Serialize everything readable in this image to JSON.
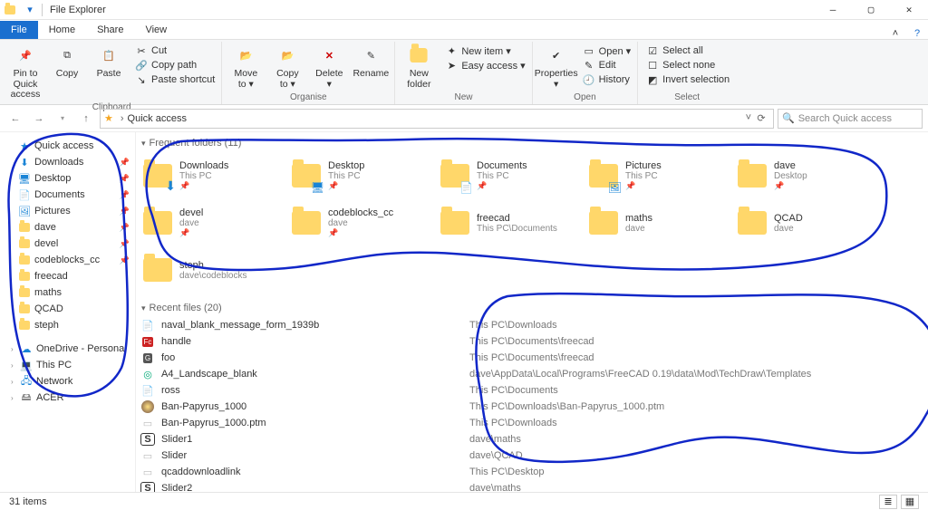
{
  "titlebar": {
    "title": "File Explorer"
  },
  "winbtns": {
    "min": "—",
    "max": "▢",
    "close": "✕"
  },
  "tabs": {
    "file": "File",
    "home": "Home",
    "share": "Share",
    "view": "View",
    "collapse": "˄",
    "help": "?"
  },
  "ribbon": {
    "clipboard": {
      "pin": "Pin to Quick\naccess",
      "copy": "Copy",
      "paste": "Paste",
      "cut": "Cut",
      "copypath": "Copy path",
      "pastesc": "Paste shortcut",
      "label": "Clipboard"
    },
    "organise": {
      "move": "Move\nto ▾",
      "copyto": "Copy\nto ▾",
      "delete": "Delete\n▾",
      "rename": "Rename",
      "label": "Organise"
    },
    "new": {
      "folder": "New\nfolder",
      "item": "New item ▾",
      "easy": "Easy access ▾",
      "label": "New"
    },
    "open": {
      "props": "Properties\n▾",
      "open": "Open ▾",
      "edit": "Edit",
      "history": "History",
      "label": "Open"
    },
    "select": {
      "all": "Select all",
      "none": "Select none",
      "invert": "Invert selection",
      "label": "Select"
    }
  },
  "address": {
    "back": "←",
    "fwd": "→",
    "up": "↑",
    "star_seg": "Quick access",
    "dropdown": "˅",
    "refresh": "⟳",
    "search_placeholder": "Search Quick access"
  },
  "sidebar": {
    "items": [
      {
        "icon": "star",
        "label": "Quick access",
        "pin": ""
      },
      {
        "icon": "dl",
        "label": "Downloads",
        "pin": "📌"
      },
      {
        "icon": "desk",
        "label": "Desktop",
        "pin": "📌"
      },
      {
        "icon": "doc",
        "label": "Documents",
        "pin": "📌"
      },
      {
        "icon": "pic",
        "label": "Pictures",
        "pin": "📌"
      },
      {
        "icon": "folder",
        "label": "dave",
        "pin": "📌"
      },
      {
        "icon": "folder",
        "label": "devel",
        "pin": "📌"
      },
      {
        "icon": "folder",
        "label": "codeblocks_cc",
        "pin": "📌"
      },
      {
        "icon": "folder",
        "label": "freecad",
        "pin": ""
      },
      {
        "icon": "folder",
        "label": "maths",
        "pin": ""
      },
      {
        "icon": "folder",
        "label": "QCAD",
        "pin": ""
      },
      {
        "icon": "folder",
        "label": "steph",
        "pin": ""
      }
    ],
    "extra": [
      {
        "icon": "cloud",
        "label": "OneDrive - Personal"
      },
      {
        "icon": "pc",
        "label": "This PC"
      },
      {
        "icon": "net",
        "label": "Network"
      },
      {
        "icon": "drive",
        "label": "ACER"
      }
    ]
  },
  "sections": {
    "folders_hdr": "Frequent folders (11)",
    "recent_hdr": "Recent files (20)"
  },
  "folders": [
    {
      "name": "Downloads",
      "loc": "This PC",
      "pin": true,
      "tint": "dl"
    },
    {
      "name": "Desktop",
      "loc": "This PC",
      "pin": true,
      "tint": "desk"
    },
    {
      "name": "Documents",
      "loc": "This PC",
      "pin": true,
      "tint": "doc"
    },
    {
      "name": "Pictures",
      "loc": "This PC",
      "pin": true,
      "tint": "pic"
    },
    {
      "name": "dave",
      "loc": "Desktop",
      "pin": true,
      "tint": "folder"
    },
    {
      "name": "devel",
      "loc": "dave",
      "pin": true,
      "tint": "folder"
    },
    {
      "name": "codeblocks_cc",
      "loc": "dave",
      "pin": true,
      "tint": "folder"
    },
    {
      "name": "freecad",
      "loc": "This PC\\Documents",
      "pin": false,
      "tint": "folder"
    },
    {
      "name": "maths",
      "loc": "dave",
      "pin": false,
      "tint": "folder"
    },
    {
      "name": "QCAD",
      "loc": "dave",
      "pin": false,
      "tint": "folder"
    },
    {
      "name": "steph",
      "loc": "dave\\codeblocks",
      "pin": false,
      "tint": "folder"
    }
  ],
  "recent": [
    {
      "name": "naval_blank_message_form_1939b",
      "loc": "This PC\\Downloads",
      "ico": "doc"
    },
    {
      "name": "handle",
      "loc": "This PC\\Documents\\freecad",
      "ico": "fc"
    },
    {
      "name": "foo",
      "loc": "This PC\\Documents\\freecad",
      "ico": "fc2"
    },
    {
      "name": "A4_Landscape_blank",
      "loc": "dave\\AppData\\Local\\Programs\\FreeCAD 0.19\\data\\Mod\\TechDraw\\Templates",
      "ico": "edge"
    },
    {
      "name": "ross",
      "loc": "This PC\\Documents",
      "ico": "doc"
    },
    {
      "name": "Ban-Papyrus_1000",
      "loc": "This PC\\Downloads\\Ban-Papyrus_1000.ptm",
      "ico": "img"
    },
    {
      "name": "Ban-Papyrus_1000.ptm",
      "loc": "This PC\\Downloads",
      "ico": "blank"
    },
    {
      "name": "Slider1",
      "loc": "dave\\maths",
      "ico": "s"
    },
    {
      "name": "Slider",
      "loc": "dave\\QCAD",
      "ico": "blank"
    },
    {
      "name": "qcaddownloadlink",
      "loc": "This PC\\Desktop",
      "ico": "blank"
    },
    {
      "name": "Slider2",
      "loc": "dave\\maths",
      "ico": "s"
    }
  ],
  "status": {
    "count_label": "31 items"
  }
}
